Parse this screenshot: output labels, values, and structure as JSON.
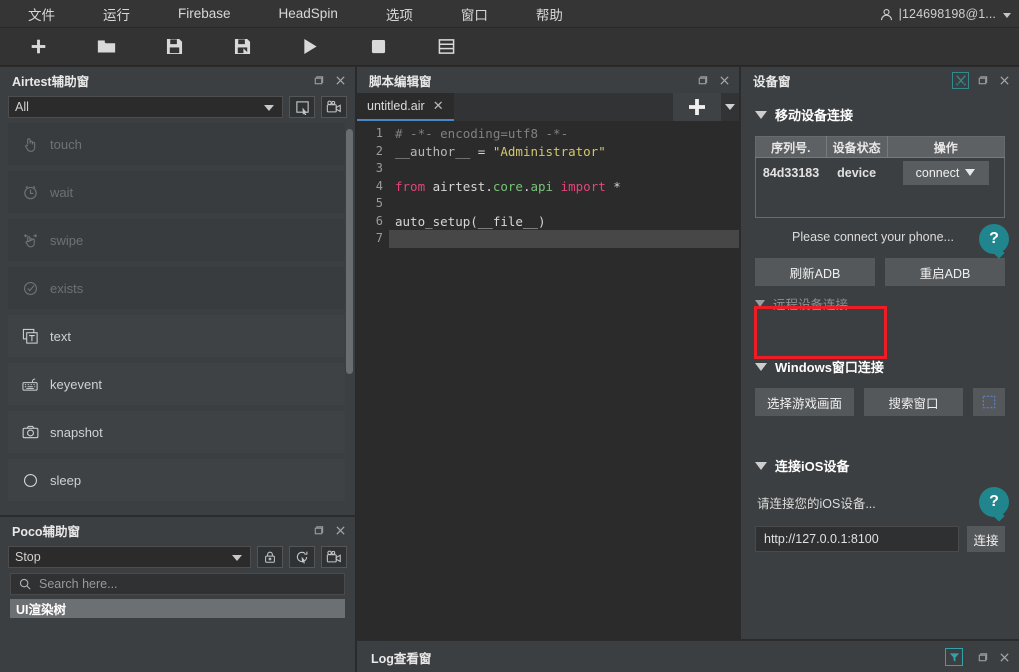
{
  "menu": {
    "items": [
      {
        "label": "文件",
        "name": "menu-file"
      },
      {
        "label": "运行",
        "name": "menu-run"
      },
      {
        "label": "Firebase",
        "name": "menu-firebase"
      },
      {
        "label": "HeadSpin",
        "name": "menu-headspin"
      },
      {
        "label": "选项",
        "name": "menu-options"
      },
      {
        "label": "窗口",
        "name": "menu-window"
      },
      {
        "label": "帮助",
        "name": "menu-help"
      }
    ],
    "user": "|124698198@1..."
  },
  "toolbar": {
    "buttons": [
      {
        "icon": "new-file-icon",
        "label": "新建"
      },
      {
        "icon": "open-folder-icon",
        "label": "打开"
      },
      {
        "icon": "save-icon",
        "label": "保存"
      },
      {
        "icon": "save-as-icon",
        "label": "另存为"
      },
      {
        "icon": "run-icon",
        "label": "运行"
      },
      {
        "icon": "stop-icon",
        "label": "停止"
      },
      {
        "icon": "log-icon",
        "label": "日志"
      }
    ]
  },
  "airtest": {
    "title": "Airtest辅助窗",
    "filter_value": "All",
    "actions": [
      {
        "label": "touch",
        "icon": "touch-icon",
        "state": "dim"
      },
      {
        "label": "wait",
        "icon": "clock-icon",
        "state": "dim"
      },
      {
        "label": "swipe",
        "icon": "swipe-icon",
        "state": "dim"
      },
      {
        "label": "exists",
        "icon": "check-circle-icon",
        "state": "dim"
      },
      {
        "label": "text",
        "icon": "text-box-icon",
        "state": "norm"
      },
      {
        "label": "keyevent",
        "icon": "keyboard-icon",
        "state": "norm"
      },
      {
        "label": "snapshot",
        "icon": "camera-icon",
        "state": "norm"
      },
      {
        "label": "sleep",
        "icon": "moon-icon",
        "state": "norm"
      }
    ]
  },
  "poco": {
    "title": "Poco辅助窗",
    "mode_value": "Stop",
    "search_placeholder": "Search here...",
    "tree_root": "UI渲染树"
  },
  "editor": {
    "title": "脚本编辑窗",
    "tab_name": "untitled.air",
    "line_numbers": [
      "1",
      "2",
      "3",
      "4",
      "5",
      "6",
      "7"
    ],
    "lines": [
      [
        {
          "t": "# -*- encoding=utf8 -*-",
          "c": "comment"
        }
      ],
      [
        {
          "t": "__author__",
          "c": "var"
        },
        {
          "t": " = ",
          "c": "op"
        },
        {
          "t": "\"Administrator\"",
          "c": "string"
        }
      ],
      [],
      [
        {
          "t": "from",
          "c": "kw"
        },
        {
          "t": " airtest",
          "c": "plain"
        },
        {
          "t": ".",
          "c": "plain"
        },
        {
          "t": "core",
          "c": "green"
        },
        {
          "t": ".",
          "c": "plain"
        },
        {
          "t": "api",
          "c": "green"
        },
        {
          "t": " ",
          "c": "plain"
        },
        {
          "t": "import",
          "c": "kw"
        },
        {
          "t": " *",
          "c": "plain"
        }
      ],
      [],
      [
        {
          "t": "auto_setup(__file__)",
          "c": "plain"
        }
      ],
      []
    ]
  },
  "device": {
    "title": "设备窗",
    "mobile_section": "移动设备连接",
    "table_headers": [
      "序列号.",
      "设备状态",
      "操作"
    ],
    "table_rows": [
      {
        "serial": "84d33183",
        "status": "device",
        "action": "connect"
      }
    ],
    "connect_hint": "Please connect your phone...",
    "help_glyph": "?",
    "refresh_adb": "刷新ADB",
    "restart_adb": "重启ADB",
    "remote_section": "远程设备连接",
    "windows_section": "Windows窗口连接",
    "select_game_screen": "选择游戏画面",
    "search_window": "搜索窗口",
    "ios_section": "连接iOS设备",
    "ios_hint": "请连接您的iOS设备...",
    "ios_url": "http://127.0.0.1:8100",
    "ios_connect": "连接"
  },
  "log": {
    "title": "Log查看窗"
  },
  "colors": {
    "accent_blue": "#4a88c7",
    "teal": "#20858c",
    "highlight_red": "#ee1c25",
    "panel_bg": "#3c3f41",
    "editor_bg": "#2b2b2b"
  }
}
